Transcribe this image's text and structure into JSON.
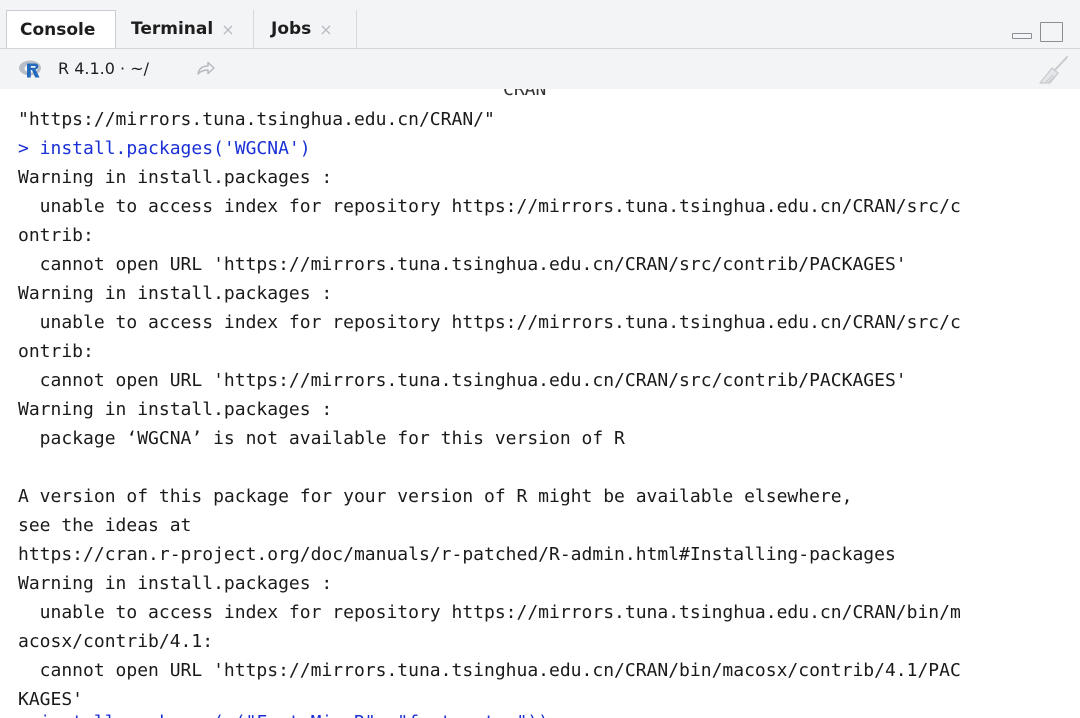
{
  "tabs": [
    {
      "label": "Console",
      "closable": false,
      "active": true
    },
    {
      "label": "Terminal",
      "closable": true,
      "active": false
    },
    {
      "label": "Jobs",
      "closable": true,
      "active": false
    }
  ],
  "close_glyph": "×",
  "path_bar": {
    "r_version": "R 4.1.0 · ~/",
    "icons": [
      "r-logo-icon",
      "go-to-directory-icon",
      "clear-console-icon"
    ]
  },
  "colors": {
    "input_text": "#1a30d6",
    "output_text": "#1a1a1a",
    "r_logo_blue": "#2369bc"
  },
  "console": {
    "top_fragment": "CRAN",
    "lines": [
      {
        "text": "\"https://mirrors.tuna.tsinghua.edu.cn/CRAN/\"",
        "kind": "output"
      },
      {
        "text": "> install.packages('WGCNA')",
        "kind": "input"
      },
      {
        "text": "Warning in install.packages :",
        "kind": "output"
      },
      {
        "text": "  unable to access index for repository https://mirrors.tuna.tsinghua.edu.cn/CRAN/src/c",
        "kind": "output"
      },
      {
        "text": "ontrib:",
        "kind": "output"
      },
      {
        "text": "  cannot open URL 'https://mirrors.tuna.tsinghua.edu.cn/CRAN/src/contrib/PACKAGES'",
        "kind": "output"
      },
      {
        "text": "Warning in install.packages :",
        "kind": "output"
      },
      {
        "text": "  unable to access index for repository https://mirrors.tuna.tsinghua.edu.cn/CRAN/src/c",
        "kind": "output"
      },
      {
        "text": "ontrib:",
        "kind": "output"
      },
      {
        "text": "  cannot open URL 'https://mirrors.tuna.tsinghua.edu.cn/CRAN/src/contrib/PACKAGES'",
        "kind": "output"
      },
      {
        "text": "Warning in install.packages :",
        "kind": "output"
      },
      {
        "text": "  package ‘WGCNA’ is not available for this version of R",
        "kind": "output"
      },
      {
        "text": "",
        "kind": "output"
      },
      {
        "text": "A version of this package for your version of R might be available elsewhere,",
        "kind": "output"
      },
      {
        "text": "see the ideas at",
        "kind": "output"
      },
      {
        "text": "https://cran.r-project.org/doc/manuals/r-patched/R-admin.html#Installing-packages",
        "kind": "output"
      },
      {
        "text": "Warning in install.packages :",
        "kind": "output"
      },
      {
        "text": "  unable to access index for repository https://mirrors.tuna.tsinghua.edu.cn/CRAN/bin/m",
        "kind": "output"
      },
      {
        "text": "acosx/contrib/4.1:",
        "kind": "output"
      },
      {
        "text": "  cannot open URL 'https://mirrors.tuna.tsinghua.edu.cn/CRAN/bin/macosx/contrib/4.1/PAC",
        "kind": "output"
      },
      {
        "text": "KAGES'",
        "kind": "output"
      },
      {
        "text": "> install.packages(c(\"FactoMineR\", \"factoextra\"))",
        "kind": "input"
      }
    ]
  }
}
